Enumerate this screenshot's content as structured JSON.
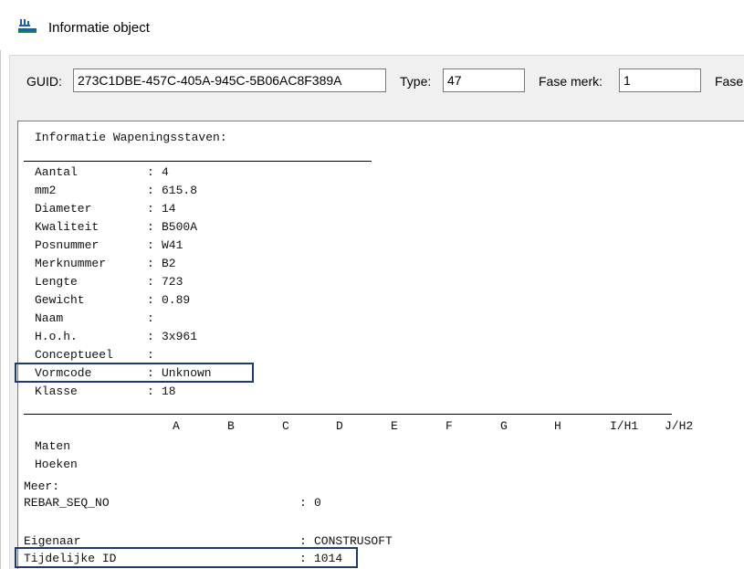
{
  "window": {
    "title": "Informatie object"
  },
  "toolbar": {
    "guid_label": "GUID:",
    "guid_value": "273C1DBE-457C-405A-945C-5B06AC8F389A",
    "type_label": "Type:",
    "type_value": "47",
    "fase_merk_label": "Fase merk:",
    "fase_merk_value": "1",
    "fase_label": "Fase"
  },
  "info": {
    "heading": "Informatie Wapeningsstaven:",
    "properties": [
      {
        "key": "Aantal",
        "value": "4"
      },
      {
        "key": "mm2",
        "value": "615.8"
      },
      {
        "key": "Diameter",
        "value": "14"
      },
      {
        "key": "Kwaliteit",
        "value": "B500A"
      },
      {
        "key": "Posnummer",
        "value": "W41"
      },
      {
        "key": "Merknummer",
        "value": "B2"
      },
      {
        "key": "Lengte",
        "value": "723"
      },
      {
        "key": "Gewicht",
        "value": "0.89"
      },
      {
        "key": "Naam",
        "value": ""
      },
      {
        "key": "H.o.h.",
        "value": "3x961"
      },
      {
        "key": "Conceptueel",
        "value": ""
      },
      {
        "key": "Vormcode",
        "value": "Unknown"
      },
      {
        "key": "Klasse",
        "value": "18"
      }
    ],
    "dimension_headers": [
      "A",
      "B",
      "C",
      "D",
      "E",
      "F",
      "G",
      "H",
      "I/H1",
      "J/H2"
    ],
    "maten_label": "Maten",
    "hoeken_label": "Hoeken",
    "meer_label": "Meer:",
    "extra": [
      {
        "key": "REBAR_SEQ_NO",
        "value": "0"
      },
      {
        "key": "Eigenaar",
        "value": "CONSTRUSOFT"
      },
      {
        "key": "Tijdelijke ID",
        "value": "1014"
      }
    ]
  }
}
